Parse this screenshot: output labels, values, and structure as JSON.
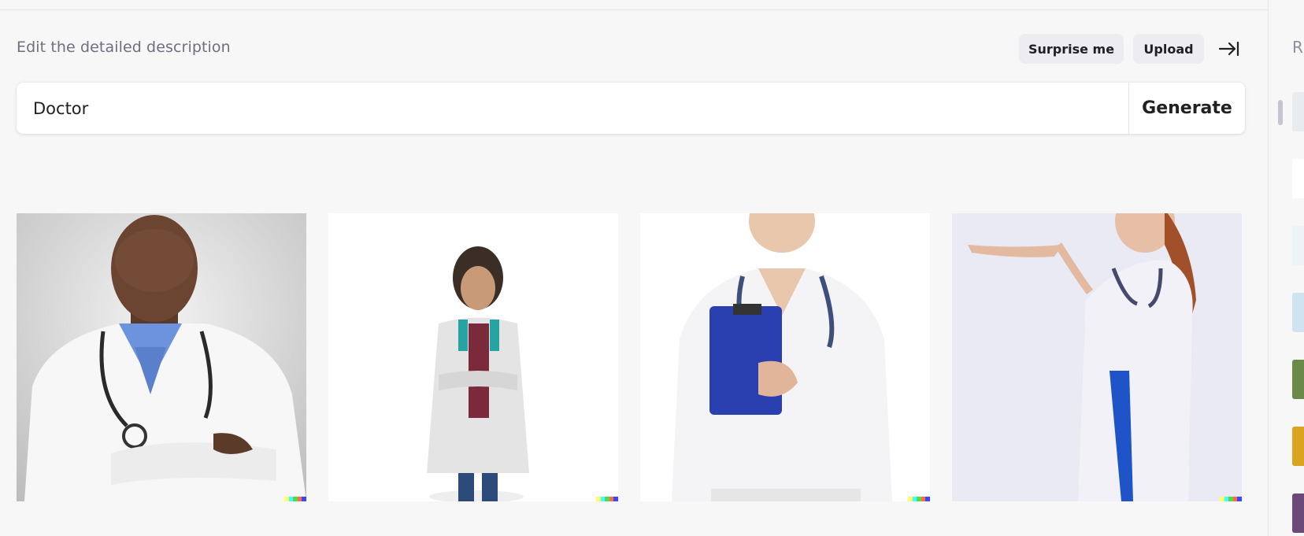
{
  "header": {
    "instruction": "Edit the detailed description",
    "surprise_label": "Surprise me",
    "upload_label": "Upload",
    "collapse_icon": "arrow-right-to-bar-icon"
  },
  "prompt": {
    "value": "Doctor",
    "generate_label": "Generate"
  },
  "results": [
    {
      "subject": "man-in-white-coat-with-stethoscope",
      "signature_colors": [
        "#ffff66",
        "#42ffff",
        "#51da4c",
        "#ff6e3c",
        "#3c46ff"
      ]
    },
    {
      "subject": "woman-in-lab-coat-arms-crossed",
      "signature_colors": [
        "#ffff66",
        "#42ffff",
        "#51da4c",
        "#ff6e3c",
        "#3c46ff"
      ]
    },
    {
      "subject": "nurse-holding-blue-clipboard",
      "signature_colors": [
        "#ffff66",
        "#42ffff",
        "#51da4c",
        "#ff6e3c",
        "#3c46ff"
      ]
    },
    {
      "subject": "woman-doctor-presenting-hands",
      "signature_colors": [
        "#ffff66",
        "#42ffff",
        "#51da4c",
        "#ff6e3c",
        "#3c46ff"
      ]
    }
  ],
  "sidebar": {
    "label": "R",
    "thumbs": [
      "#e8ecf0",
      "#ffffff",
      "#eef3f8",
      "#cfe3f0",
      "#6b8a4a",
      "#d9a520",
      "#6b4a7a"
    ]
  },
  "colors": {
    "background": "#f7f7f8",
    "button_bg": "#ececf1",
    "text": "#202123",
    "muted_text": "#6e6e80"
  }
}
